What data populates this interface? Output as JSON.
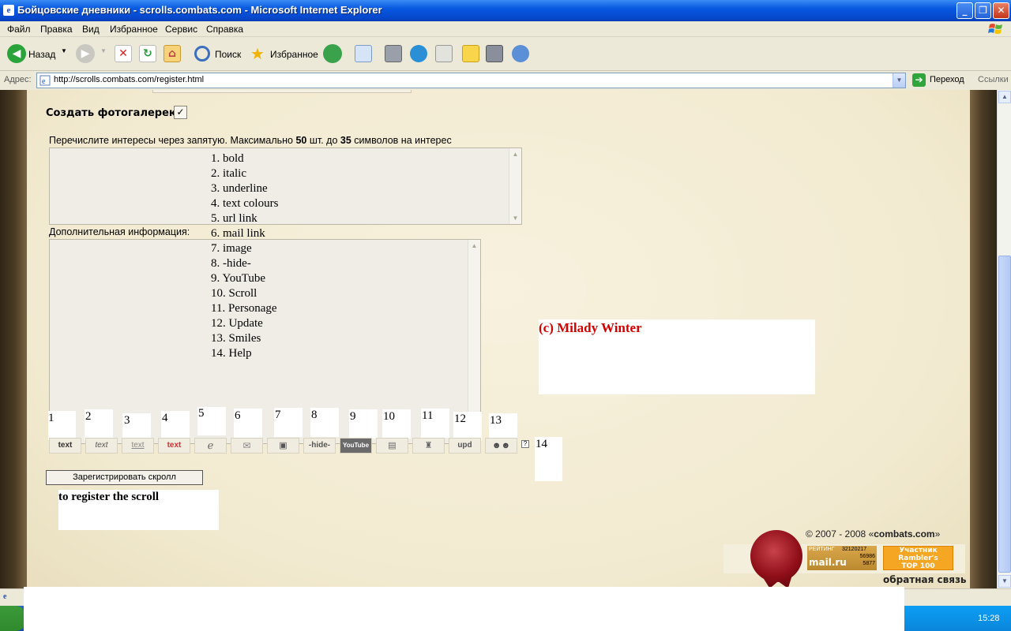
{
  "window": {
    "title": "Бойцовские дневники - scrolls.combats.com - Microsoft Internet Explorer",
    "minimize": "_",
    "maximize": "❐",
    "close": "✕"
  },
  "menu": [
    "Файл",
    "Правка",
    "Вид",
    "Избранное",
    "Сервис",
    "Справка"
  ],
  "toolbar": {
    "back": "Назад",
    "search": "Поиск",
    "favorites": "Избранное"
  },
  "address": {
    "label": "Адрес:",
    "url": "http://scrolls.combats.com/register.html",
    "go": "Переход",
    "links": "Ссылки"
  },
  "form": {
    "gallery_label": "Создать фотогалерею:",
    "gallery_checked": "✓",
    "interests_instruction": {
      "pre": "Перечислите интересы через запятую. Максимально ",
      "max_count": "50",
      "mid": " шт. до ",
      "max_chars": "35",
      "post": " символов на интерес"
    },
    "extra_info_label": "Дополнительная информация:",
    "register_button": "Зарегистрировать скролл",
    "register_note": "to register the scroll"
  },
  "annotation_list": [
    "1. bold",
    "2. italic",
    "3. underline",
    "4. text colours",
    "5. url link",
    "6. mail link",
    "7. image",
    "8. -hide-",
    "9. YouTube",
    "10. Scroll",
    "11. Personage",
    "12. Update",
    "13. Smiles",
    "14. Help"
  ],
  "annotation_numbers": [
    "1",
    "2",
    "3",
    "4",
    "5",
    "6",
    "7",
    "8",
    "9",
    "10",
    "11",
    "12",
    "13",
    "14"
  ],
  "format_buttons": [
    "text",
    "text",
    "text",
    "text",
    "",
    "",
    "",
    "-hide-",
    "YouTube",
    "",
    "",
    "upd",
    "",
    ""
  ],
  "credit": "(c) Milady Winter",
  "footer": {
    "copyright_pre": "© 2007 - 2008 «",
    "copyright_site": "combats.com",
    "copyright_post": "»",
    "mailru_label": "РЕЙТИНГ",
    "mailru_count1": "32120217",
    "mailru_count2": "56986",
    "mailru_count3": "5877",
    "mailru_logo": "mail.ru",
    "rambler_l1": "Участник",
    "rambler_l2": "Rambler's",
    "rambler_l3": "TOP 100",
    "feedback": "обратная связь"
  },
  "taskbar": {
    "clock": "15:28"
  },
  "colors": {
    "credit_red": "#d40000",
    "parchment": "#f2ead0",
    "seal": "#8f0e18"
  }
}
